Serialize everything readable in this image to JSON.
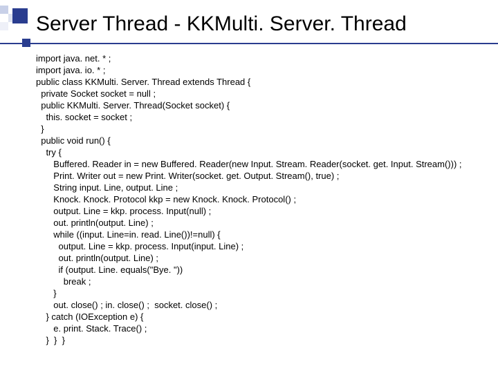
{
  "title": "Server Thread -  KKMulti. Server. Thread",
  "code_lines": [
    "import java. net. * ;",
    "import java. io. * ;",
    "public class KKMulti. Server. Thread extends Thread {",
    "  private Socket socket = null ;",
    "  public KKMulti. Server. Thread(Socket socket) {",
    "    this. socket = socket ;",
    "  }",
    "  public void run() {",
    "    try {",
    "       Buffered. Reader in = new Buffered. Reader(new Input. Stream. Reader(socket. get. Input. Stream())) ;",
    "       Print. Writer out = new Print. Writer(socket. get. Output. Stream(), true) ;",
    "       String input. Line, output. Line ;",
    "       Knock. Knock. Protocol kkp = new Knock. Knock. Protocol() ;",
    "       output. Line = kkp. process. Input(null) ;",
    "       out. println(output. Line) ;",
    "       while ((input. Line=in. read. Line())!=null) {",
    "         output. Line = kkp. process. Input(input. Line) ;",
    "         out. println(output. Line) ;",
    "         if (output. Line. equals(\"Bye. \"))",
    "           break ;",
    "       }",
    "       out. close() ; in. close() ;  socket. close() ;",
    "    } catch (IOException e) {",
    "       e. print. Stack. Trace() ;",
    "    }  }  }"
  ]
}
